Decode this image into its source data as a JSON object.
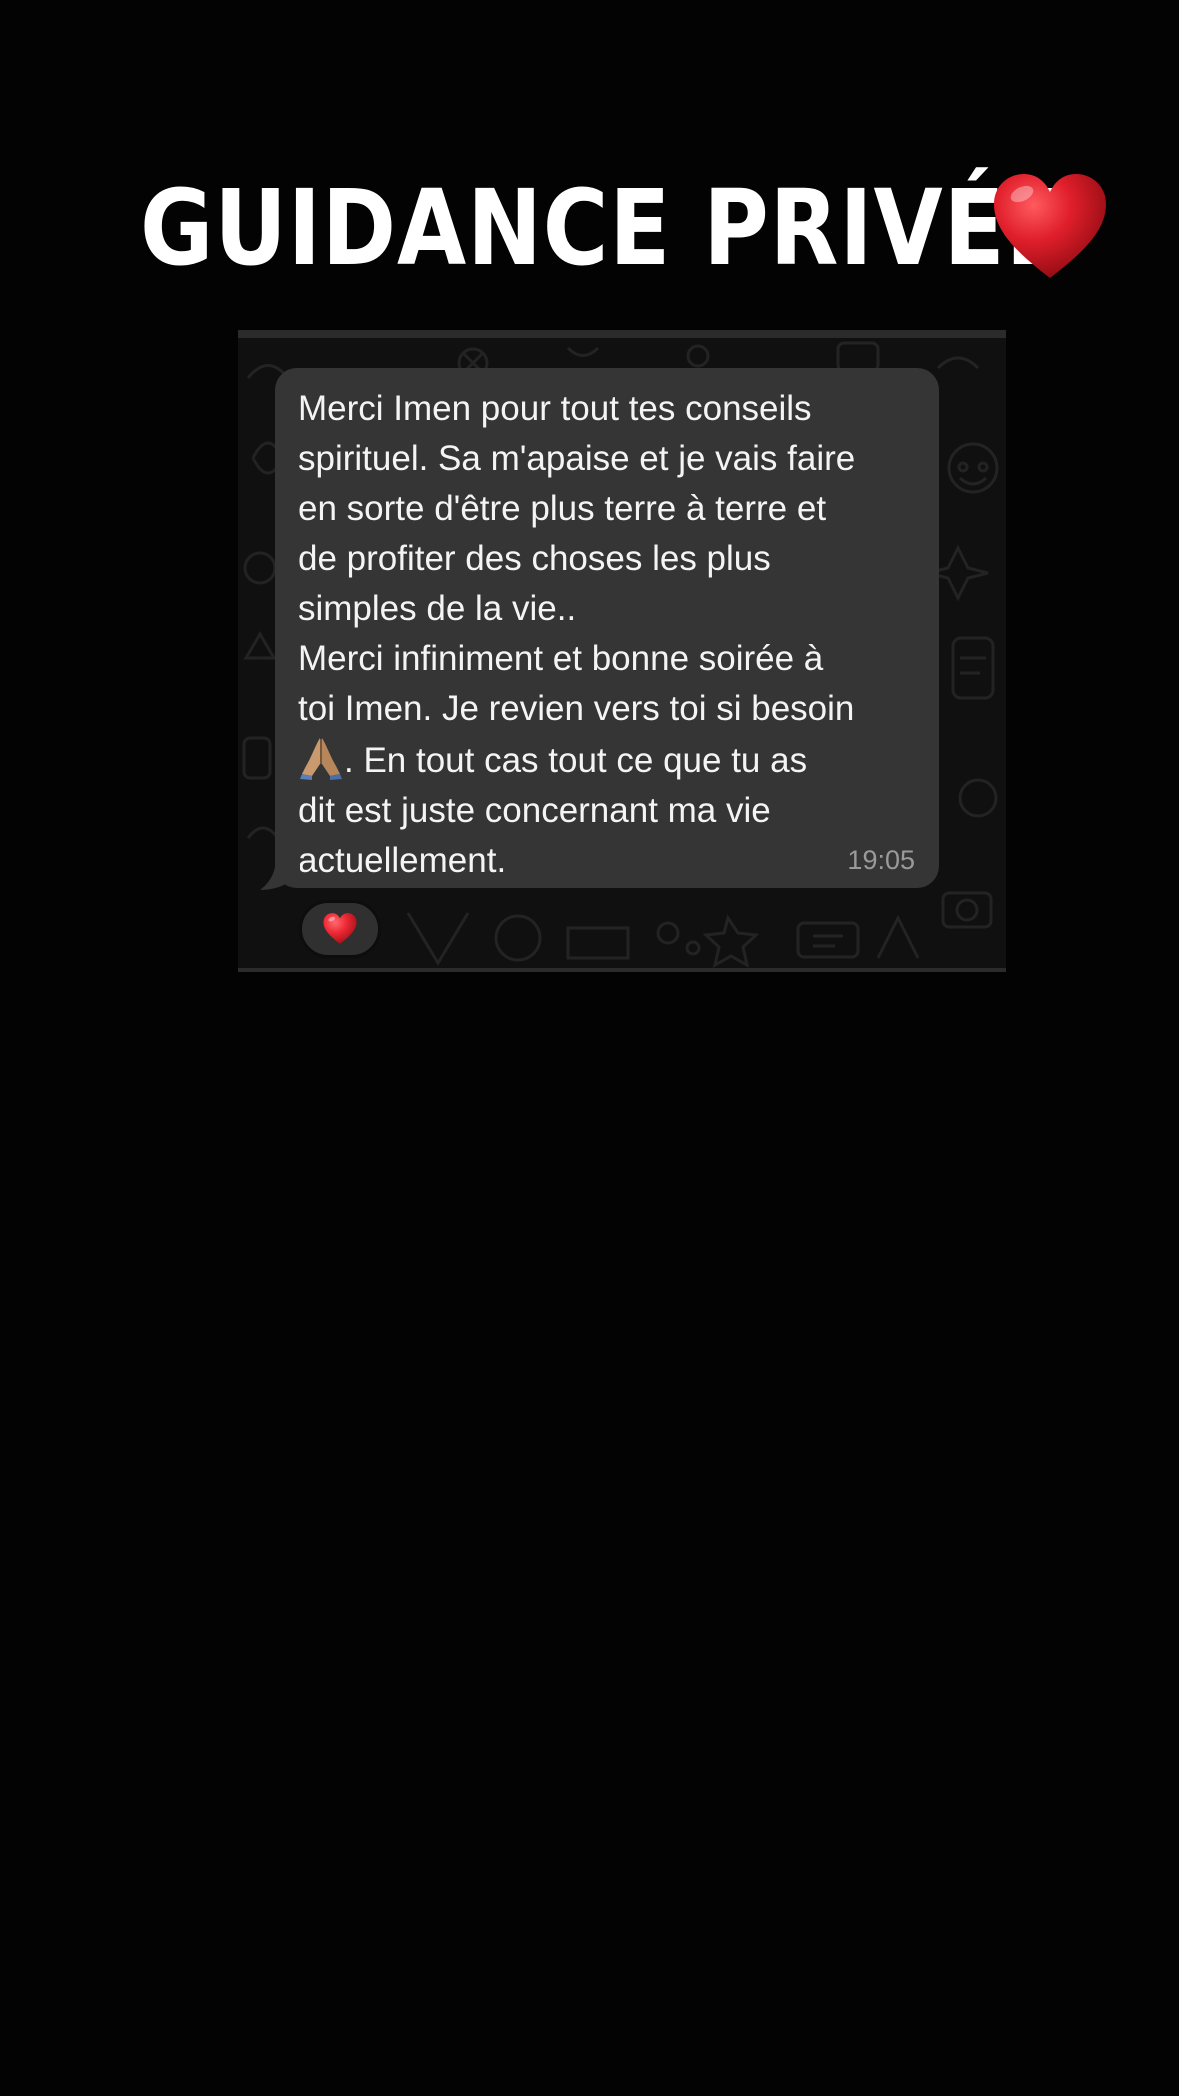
{
  "story": {
    "title": "GUIDANCE PRIVÉE",
    "title_emoji": "heart-red-icon"
  },
  "chat": {
    "message": {
      "text_before_emoji": "Merci Imen pour tout tes conseils\nspirituel. Sa m'apaise et je vais faire\nen sorte d'être plus terre à terre et\nde profiter des choses les plus\nsimples de la vie..\nMerci infiniment et bonne soirée à\ntoi Imen. Je revien vers toi si besoin\n",
      "inline_emoji": "folded-hands-icon",
      "text_after_emoji": ". En tout cas tout ce que tu as\ndit est juste concernant ma vie\nactuellement.",
      "time": "19:05"
    },
    "reaction": "heart-red-icon"
  },
  "colors": {
    "background": "#030303",
    "bubble": "#353535",
    "heart": "#e3212f"
  }
}
